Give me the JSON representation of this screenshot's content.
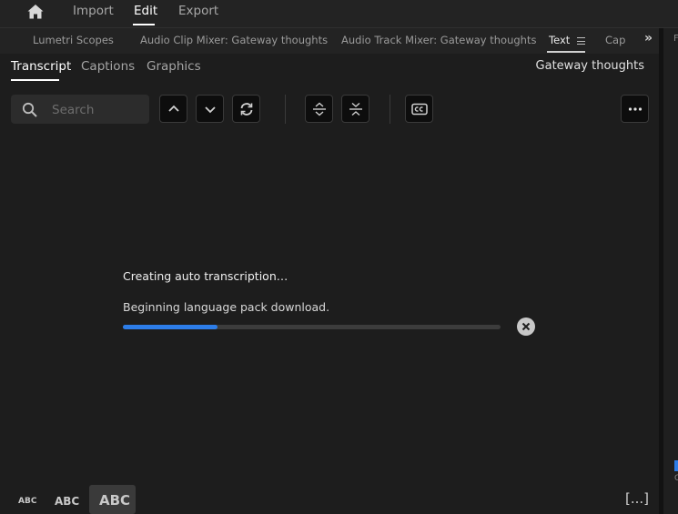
{
  "topbar": {
    "home_icon": "home-icon",
    "nav": [
      "Import",
      "Edit",
      "Export"
    ],
    "active": "Edit"
  },
  "panel_tabs": {
    "items": [
      "Lumetri Scopes",
      "Audio Clip Mixer: Gateway thoughts",
      "Audio Track Mixer: Gateway thoughts",
      "Text",
      "Cap"
    ],
    "active": "Text",
    "menu_icon": "hamburger-icon",
    "overflow_icon": "double-chevron-right-icon"
  },
  "text_panel": {
    "subtabs": [
      "Transcript",
      "Captions",
      "Graphics"
    ],
    "active_subtab": "Transcript",
    "sequence_name": "Gateway thoughts",
    "search": {
      "placeholder": "Search",
      "value": ""
    },
    "toolbar_icons": [
      "chevron-up-icon",
      "chevron-down-icon",
      "refresh-icon",
      "expand-rows-icon",
      "collapse-rows-icon",
      "cc-icon",
      "more-icon"
    ]
  },
  "status": {
    "title": "Creating auto transcription…",
    "message": "Beginning language pack download.",
    "progress": 0.25,
    "accent": "#2d7de8"
  },
  "bottom": {
    "text_sizes": [
      "ABC",
      "ABC",
      "ABC"
    ],
    "selected_size": 2,
    "expand_label": "[...]"
  },
  "right_panel": {
    "letter": "F",
    "mark": "C"
  }
}
